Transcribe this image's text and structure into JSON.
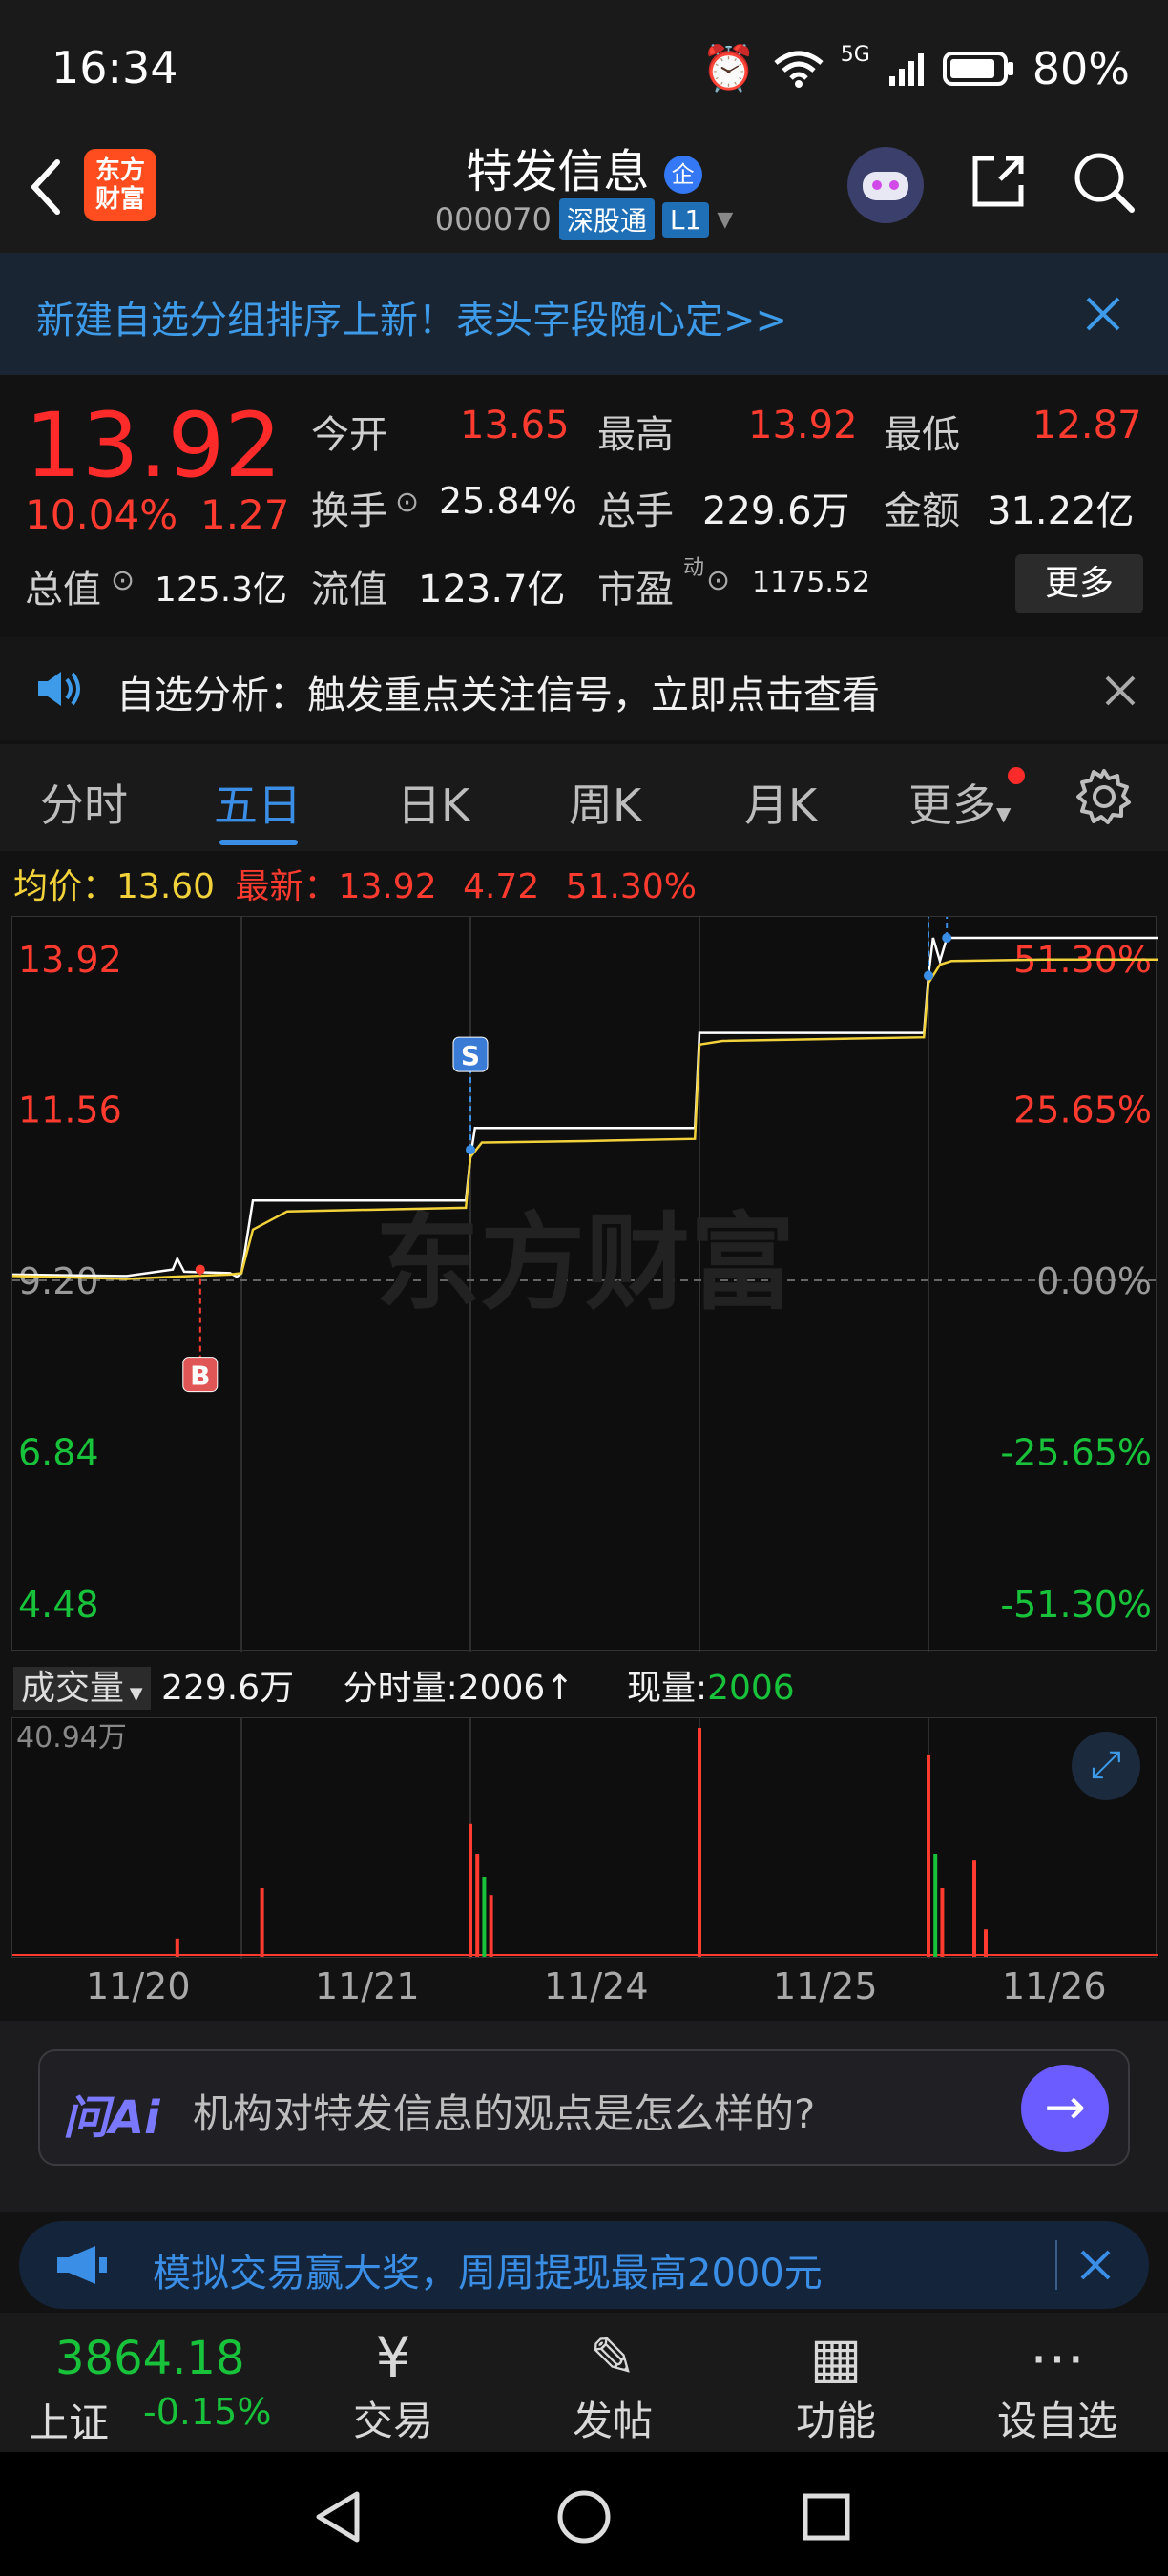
{
  "status_bar": {
    "time": "16:34",
    "battery": "80%",
    "network": "5G"
  },
  "header": {
    "back_icon": "chevron-left-icon",
    "logo_text_line1": "东方",
    "logo_text_line2": "财富",
    "stock_name": "特发信息",
    "badge": "企",
    "stock_code": "000070",
    "market_tag": "深股通",
    "level_tag": "L1"
  },
  "banner": {
    "text": "新建自选分组排序上新！表头字段随心定>>"
  },
  "quote": {
    "price": "13.92",
    "change_pct": "10.04%",
    "change_abs": "1.27",
    "open_label": "今开",
    "open_value": "13.65",
    "high_label": "最高",
    "high_value": "13.92",
    "low_label": "最低",
    "low_value": "12.87",
    "turnover_label": "换手",
    "turnover_value": "25.84%",
    "volume_label": "总手",
    "volume_value": "229.6万",
    "amount_label": "金额",
    "amount_value": "31.22亿",
    "mktcap_label": "总值",
    "mktcap_value": "125.3亿",
    "float_label": "流值",
    "float_value": "123.7亿",
    "pe_label": "市盈",
    "pe_sup": "动",
    "pe_value": "1175.52",
    "more_label": "更多"
  },
  "notice": {
    "text": "自选分析：触发重点关注信号，立即点击查看"
  },
  "tabs": [
    {
      "label": "分时"
    },
    {
      "label": "五日"
    },
    {
      "label": "日K"
    },
    {
      "label": "周K"
    },
    {
      "label": "月K"
    },
    {
      "label": "更多"
    }
  ],
  "chart_info": {
    "avg_label": "均价：",
    "avg_value": "13.60",
    "latest_label": "最新：",
    "latest_value": "13.92",
    "latest_change": "4.72",
    "latest_pct": "51.30%"
  },
  "chart_data": {
    "type": "line",
    "title": "",
    "x": [
      "11/20",
      "11/21",
      "11/24",
      "11/25",
      "11/26"
    ],
    "y_left_ticks": [
      "13.92",
      "11.56",
      "9.20",
      "6.84",
      "4.48"
    ],
    "y_right_ticks": [
      "51.30%",
      "25.65%",
      "0.00%",
      "-25.65%",
      "-51.30%"
    ],
    "ylim": [
      4.48,
      13.92
    ],
    "base_price": 9.2,
    "watermark": "东方财富",
    "series": [
      {
        "name": "price",
        "color": "#ffffff",
        "points": [
          [
            0.0,
            9.28
          ],
          [
            0.5,
            9.26
          ],
          [
            0.7,
            9.35
          ],
          [
            0.72,
            9.5
          ],
          [
            0.75,
            9.32
          ],
          [
            0.95,
            9.3
          ],
          [
            0.98,
            9.25
          ],
          [
            1.0,
            9.3
          ],
          [
            1.05,
            10.3
          ],
          [
            1.5,
            10.3
          ],
          [
            1.98,
            10.3
          ],
          [
            2.0,
            10.9
          ],
          [
            2.02,
            11.3
          ],
          [
            2.5,
            11.3
          ],
          [
            2.98,
            11.3
          ],
          [
            3.0,
            12.61
          ],
          [
            3.5,
            12.61
          ],
          [
            3.98,
            12.61
          ],
          [
            4.0,
            13.4
          ],
          [
            4.02,
            13.92
          ],
          [
            4.05,
            13.6
          ],
          [
            4.08,
            13.92
          ],
          [
            4.5,
            13.92
          ],
          [
            5.0,
            13.92
          ]
        ]
      },
      {
        "name": "avg",
        "color": "#f2d23b",
        "points": [
          [
            0.0,
            9.26
          ],
          [
            0.5,
            9.22
          ],
          [
            0.7,
            9.25
          ],
          [
            0.95,
            9.28
          ],
          [
            1.0,
            9.3
          ],
          [
            1.05,
            9.9
          ],
          [
            1.2,
            10.15
          ],
          [
            1.98,
            10.2
          ],
          [
            2.0,
            10.9
          ],
          [
            2.05,
            11.1
          ],
          [
            2.5,
            11.12
          ],
          [
            2.98,
            11.15
          ],
          [
            3.0,
            12.45
          ],
          [
            3.1,
            12.5
          ],
          [
            3.98,
            12.55
          ],
          [
            4.0,
            13.3
          ],
          [
            4.05,
            13.55
          ],
          [
            4.1,
            13.6
          ],
          [
            4.5,
            13.62
          ],
          [
            5.0,
            13.62
          ]
        ]
      }
    ],
    "markers": [
      {
        "type": "B",
        "day": 0.82,
        "price": 9.35
      },
      {
        "type": "S",
        "day": 2.0,
        "price": 11.0
      },
      {
        "type": "S",
        "day": 4.0,
        "price": 13.4
      },
      {
        "type": "S",
        "day": 4.08,
        "price": 13.92
      }
    ]
  },
  "volume": {
    "label": "成交量",
    "total": "229.6万",
    "tick_label": "分时量:",
    "tick_value": "2006",
    "now_label": "现量:",
    "now_value": "2006",
    "max_label": "40.94万"
  },
  "volume_data": {
    "type": "bar",
    "ylim": [
      0,
      409400
    ],
    "bars": [
      {
        "day": 0.72,
        "v": 0.08,
        "c": "#ff3b30"
      },
      {
        "day": 1.09,
        "v": 0.3,
        "c": "#ff3b30"
      },
      {
        "day": 2.0,
        "v": 0.58,
        "c": "#ff3b30"
      },
      {
        "day": 2.03,
        "v": 0.45,
        "c": "#ff3b30"
      },
      {
        "day": 2.06,
        "v": 0.35,
        "c": "#18c23a"
      },
      {
        "day": 2.09,
        "v": 0.27,
        "c": "#ff3b30"
      },
      {
        "day": 3.0,
        "v": 1.0,
        "c": "#ff3b30"
      },
      {
        "day": 4.0,
        "v": 0.88,
        "c": "#ff3b30"
      },
      {
        "day": 4.03,
        "v": 0.45,
        "c": "#18c23a"
      },
      {
        "day": 4.06,
        "v": 0.3,
        "c": "#ff3b30"
      },
      {
        "day": 4.2,
        "v": 0.42,
        "c": "#ff3b30"
      },
      {
        "day": 4.25,
        "v": 0.12,
        "c": "#ff3b30"
      }
    ]
  },
  "ai": {
    "brand": "问Ai",
    "question": "机构对特发信息的观点是怎么样的?"
  },
  "promo": {
    "text": "模拟交易赢大奖，周周提现最高2000元"
  },
  "bottom_nav": {
    "index_value": "3864.18",
    "index_name": "上证",
    "index_change": "-0.15%",
    "items": [
      {
        "label": "交易"
      },
      {
        "label": "发帖"
      },
      {
        "label": "功能"
      },
      {
        "label": "设自选"
      }
    ]
  }
}
